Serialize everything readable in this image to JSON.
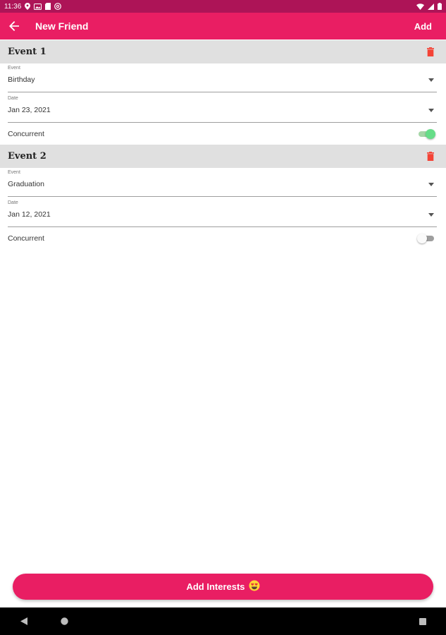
{
  "status_bar": {
    "time": "11:36",
    "left_icons": [
      "location-icon",
      "image-icon",
      "sd-card-icon",
      "at-sign-icon"
    ],
    "right_icons": [
      "wifi-icon",
      "signal-icon",
      "battery-icon"
    ]
  },
  "app_bar": {
    "title": "New Friend",
    "action_label": "Add",
    "background": "#e91e63"
  },
  "events": [
    {
      "title": "Event 1",
      "event_label": "Event",
      "event_value": "Birthday",
      "date_label": "Date",
      "date_value": "Jan 23, 2021",
      "concurrent_label": "Concurrent",
      "concurrent": true
    },
    {
      "title": "Event 2",
      "event_label": "Event",
      "event_value": "Graduation",
      "date_label": "Date",
      "date_value": "Jan 12, 2021",
      "concurrent_label": "Concurrent",
      "concurrent": false
    }
  ],
  "cta": {
    "label": "Add Interests",
    "emoji": "😍"
  },
  "colors": {
    "accent": "#e91e63",
    "status_bar": "#ad1457",
    "delete": "#f44336",
    "toggle_on": "#66dd88"
  }
}
